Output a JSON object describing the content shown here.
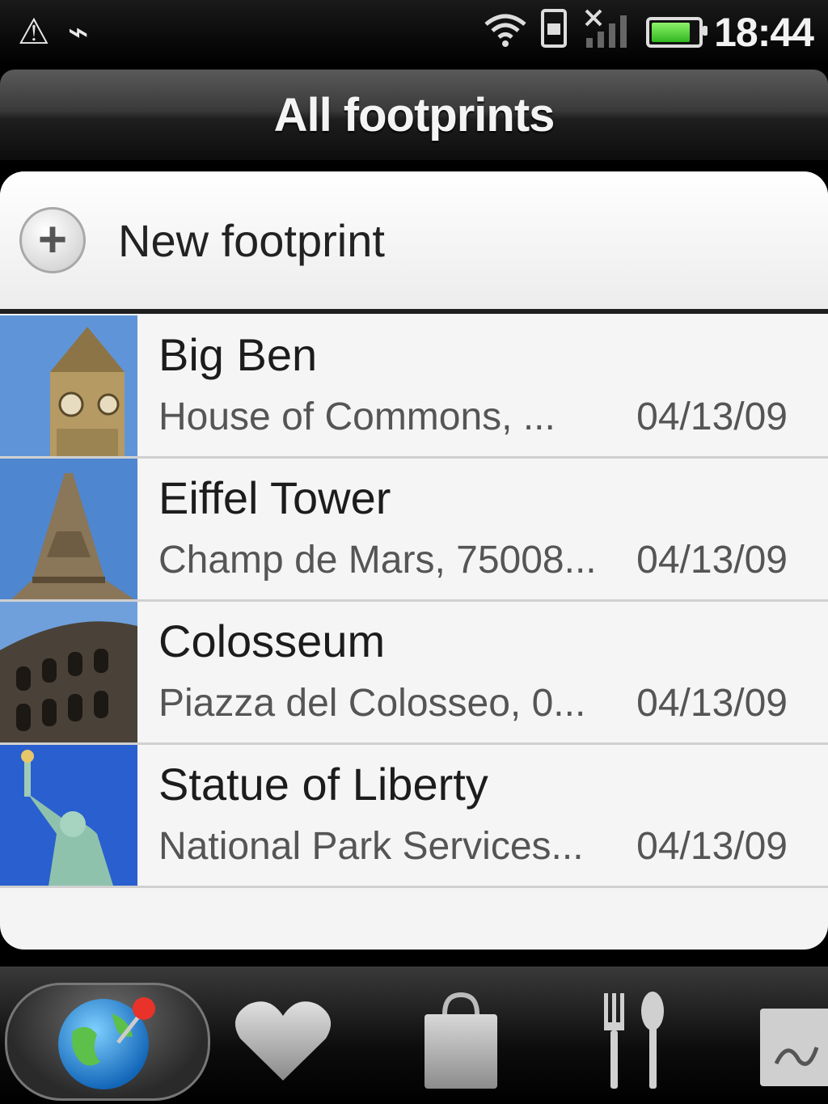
{
  "status_bar": {
    "left_icons": [
      "warning-icon",
      "usb-icon"
    ],
    "right_icons": [
      "wifi-icon",
      "sim-icon",
      "signal-icon",
      "battery-icon"
    ],
    "battery_level": 0.85,
    "time": "18:44"
  },
  "header": {
    "title": "All footprints"
  },
  "new_footprint": {
    "label": "New footprint",
    "icon": "plus-icon"
  },
  "items": [
    {
      "title": "Big Ben",
      "subtitle": "House of Commons, ...",
      "date": "04/13/09",
      "thumb": "big-ben"
    },
    {
      "title": "Eiffel Tower",
      "subtitle": "Champ de Mars, 75008...",
      "date": "04/13/09",
      "thumb": "eiffel-tower"
    },
    {
      "title": "Colosseum",
      "subtitle": "Piazza del Colosseo, 0...",
      "date": "04/13/09",
      "thumb": "colosseum"
    },
    {
      "title": "Statue of Liberty",
      "subtitle": "National Park Services...",
      "date": "04/13/09",
      "thumb": "statue-of-liberty"
    }
  ],
  "bottom_tabs": [
    {
      "name": "globe-pin-icon",
      "active": true
    },
    {
      "name": "heart-icon",
      "active": false
    },
    {
      "name": "shopping-bag-icon",
      "active": false
    },
    {
      "name": "fork-spoon-icon",
      "active": false
    },
    {
      "name": "notepad-icon",
      "active": false
    }
  ]
}
